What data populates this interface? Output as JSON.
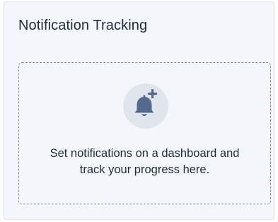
{
  "panel": {
    "title": "Notification Tracking"
  },
  "empty_state": {
    "icon": "bell-plus-icon",
    "message_line1": "Set notifications on a dashboard and",
    "message_line2": "track your progress here."
  }
}
